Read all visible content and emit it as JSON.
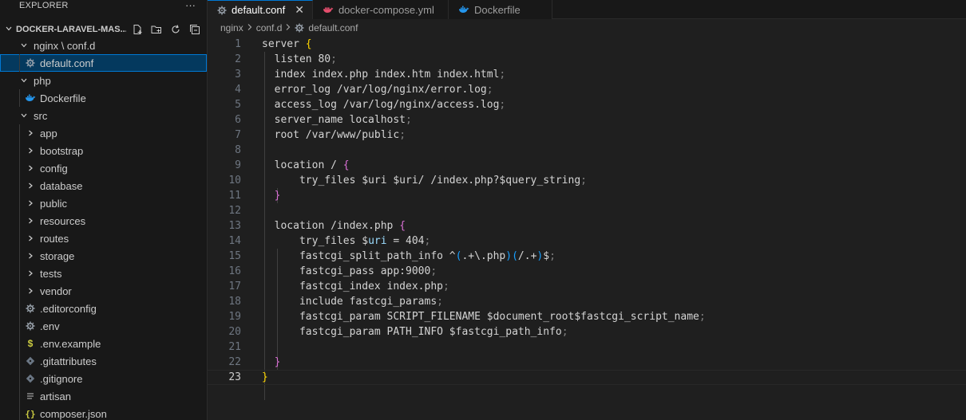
{
  "explorer": {
    "title": "EXPLORER",
    "more_glyph": "···",
    "project_name": "DOCKER-LARAVEL-MAS..."
  },
  "tree": [
    {
      "label": "nginx \\ conf.d",
      "type": "folder-open",
      "level": 0
    },
    {
      "label": "default.conf",
      "type": "gear",
      "level": 1,
      "selected": true
    },
    {
      "label": "php",
      "type": "folder-open",
      "level": 0
    },
    {
      "label": "Dockerfile",
      "type": "docker",
      "level": 1
    },
    {
      "label": "src",
      "type": "folder-open",
      "level": 0
    },
    {
      "label": "app",
      "type": "folder",
      "level": 1
    },
    {
      "label": "bootstrap",
      "type": "folder",
      "level": 1
    },
    {
      "label": "config",
      "type": "folder",
      "level": 1
    },
    {
      "label": "database",
      "type": "folder",
      "level": 1
    },
    {
      "label": "public",
      "type": "folder",
      "level": 1
    },
    {
      "label": "resources",
      "type": "folder",
      "level": 1
    },
    {
      "label": "routes",
      "type": "folder",
      "level": 1
    },
    {
      "label": "storage",
      "type": "folder",
      "level": 1
    },
    {
      "label": "tests",
      "type": "folder",
      "level": 1
    },
    {
      "label": "vendor",
      "type": "folder",
      "level": 1
    },
    {
      "label": ".editorconfig",
      "type": "gear",
      "level": 1
    },
    {
      "label": ".env",
      "type": "gear",
      "level": 1
    },
    {
      "label": ".env.example",
      "type": "dollar",
      "level": 1
    },
    {
      "label": ".gitattributes",
      "type": "git",
      "level": 1
    },
    {
      "label": ".gitignore",
      "type": "git",
      "level": 1
    },
    {
      "label": "artisan",
      "type": "lines",
      "level": 1
    },
    {
      "label": "composer.json",
      "type": "braces",
      "level": 1
    }
  ],
  "tabs": [
    {
      "label": "default.conf",
      "icon": "gear-icon",
      "active": true,
      "close": "✕"
    },
    {
      "label": "docker-compose.yml",
      "icon": "compose-icon",
      "active": false
    },
    {
      "label": "Dockerfile",
      "icon": "docker-icon",
      "active": false
    }
  ],
  "breadcrumb": [
    "nginx",
    "conf.d",
    "default.conf"
  ],
  "code_lines": [
    {
      "n": "1",
      "html": "server <span class=\"yb\">{</span>"
    },
    {
      "n": "2",
      "html": "  listen 80<span class=\"semi\">;</span>"
    },
    {
      "n": "3",
      "html": "  index index.php index.htm index.html<span class=\"semi\">;</span>"
    },
    {
      "n": "4",
      "html": "  error_log /var/log/nginx/error.log<span class=\"semi\">;</span>"
    },
    {
      "n": "5",
      "html": "  access_log /var/log/nginx/access.log<span class=\"semi\">;</span>"
    },
    {
      "n": "6",
      "html": "  server_name localhost<span class=\"semi\">;</span>"
    },
    {
      "n": "7",
      "html": "  root /var/www/public<span class=\"semi\">;</span>"
    },
    {
      "n": "8",
      "html": ""
    },
    {
      "n": "9",
      "html": "  location / <span class=\"pb\">{</span>"
    },
    {
      "n": "10",
      "html": "      try_files $uri $uri/ /index.php?$query_string<span class=\"semi\">;</span>"
    },
    {
      "n": "11",
      "html": "  <span class=\"pb\">}</span>"
    },
    {
      "n": "12",
      "html": ""
    },
    {
      "n": "13",
      "html": "  location /index.php <span class=\"pb\">{</span>"
    },
    {
      "n": "14",
      "html": "      try_files $<span class=\"var\">uri</span> = 404<span class=\"semi\">;</span>"
    },
    {
      "n": "15",
      "html": "      fastcgi_split_path_info ^<span class=\"bb\">(</span>.+\\.php<span class=\"bb\">)(</span>/.+<span class=\"bb\">)</span>$<span class=\"semi\">;</span>"
    },
    {
      "n": "16",
      "html": "      fastcgi_pass app:9000<span class=\"semi\">;</span>"
    },
    {
      "n": "17",
      "html": "      fastcgi_index index.php<span class=\"semi\">;</span>"
    },
    {
      "n": "18",
      "html": "      include fastcgi_params<span class=\"semi\">;</span>"
    },
    {
      "n": "19",
      "html": "      fastcgi_param SCRIPT_FILENAME $document_root$fastcgi_script_name<span class=\"semi\">;</span>"
    },
    {
      "n": "20",
      "html": "      fastcgi_param PATH_INFO $fastcgi_path_info<span class=\"semi\">;</span>"
    },
    {
      "n": "21",
      "html": ""
    },
    {
      "n": "22",
      "html": "  <span class=\"pb\">}</span>"
    },
    {
      "n": "23",
      "html": "<span class=\"yb\">}</span>"
    }
  ],
  "current_line": "23",
  "colors": {
    "accent": "#0078d4",
    "selection": "#04395e",
    "docker": "#2496ed",
    "compose": "#e44e6d"
  }
}
